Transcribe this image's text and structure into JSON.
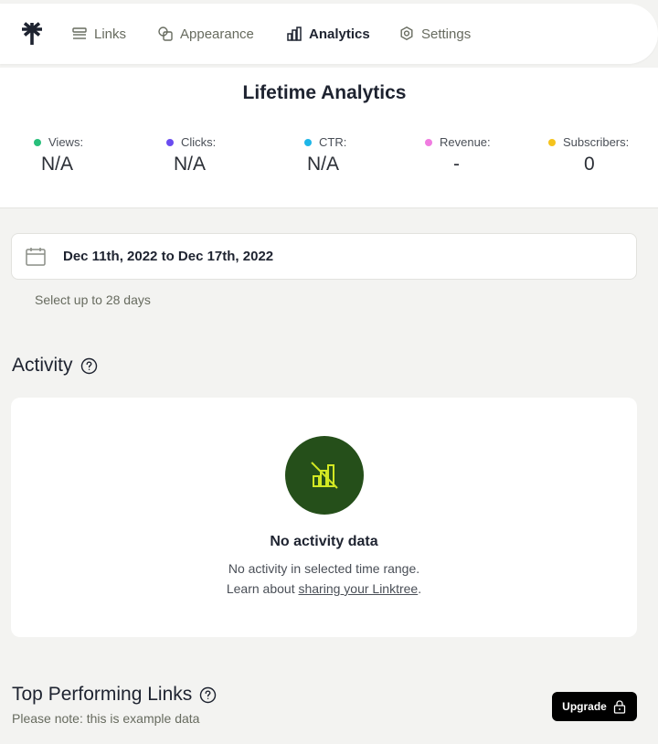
{
  "nav": {
    "items": [
      {
        "label": "Links",
        "icon": "links-icon"
      },
      {
        "label": "Appearance",
        "icon": "appearance-icon"
      },
      {
        "label": "Analytics",
        "icon": "analytics-icon",
        "active": true
      },
      {
        "label": "Settings",
        "icon": "settings-icon"
      }
    ]
  },
  "lifetime": {
    "title": "Lifetime Analytics",
    "stats": [
      {
        "label": "Views:",
        "value": "N/A",
        "color": "#28bf7b"
      },
      {
        "label": "Clicks:",
        "value": "N/A",
        "color": "#6a4cf0"
      },
      {
        "label": "CTR:",
        "value": "N/A",
        "color": "#1eb6e8"
      },
      {
        "label": "Revenue:",
        "value": "-",
        "color": "#f07ce0"
      },
      {
        "label": "Subscribers:",
        "value": "0",
        "color": "#f5c31d"
      }
    ]
  },
  "date_range": {
    "text": "Dec 11th, 2022 to Dec 17th, 2022",
    "hint": "Select up to 28 days"
  },
  "activity": {
    "title": "Activity",
    "empty_title": "No activity data",
    "empty_line1": "No activity in selected time range.",
    "empty_line2_prefix": "Learn about ",
    "empty_link": "sharing your Linktree",
    "empty_line2_suffix": "."
  },
  "top_links": {
    "title": "Top Performing Links",
    "note": "Please note: this is example data",
    "upgrade_label": "Upgrade"
  },
  "colors": {
    "accent_green": "#254f1a",
    "icon_lime": "#d2e823"
  }
}
